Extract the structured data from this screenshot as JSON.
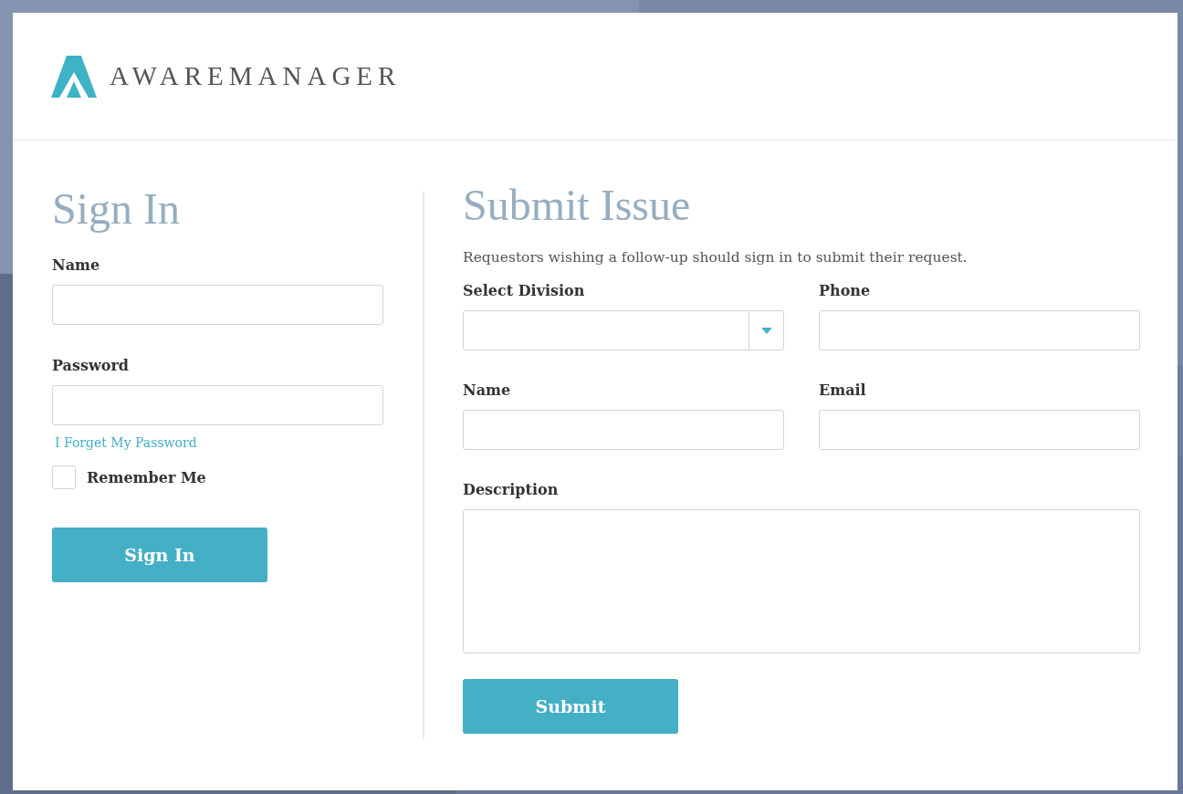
{
  "logo": {
    "text": "AWAREMANAGER"
  },
  "sign_in": {
    "title": "Sign In",
    "fields": [
      {
        "label": "Name"
      },
      {
        "label": "Password"
      }
    ],
    "forgot_link": "I Forget My Password",
    "remember_me": {
      "label": "Remember Me",
      "checked": false
    },
    "button": "Sign In"
  },
  "submit_issue": {
    "title": "Submit Issue",
    "description": "Requestors wishing a follow-up should sign in to submit their request.",
    "fields": [
      {
        "label": "Select Division",
        "kind": "select"
      },
      {
        "label": "Phone",
        "kind": "text"
      },
      {
        "label": "Name",
        "kind": "text"
      },
      {
        "label": "Email",
        "kind": "text"
      },
      {
        "label": "Description",
        "kind": "textarea"
      }
    ],
    "button": "Submit"
  }
}
